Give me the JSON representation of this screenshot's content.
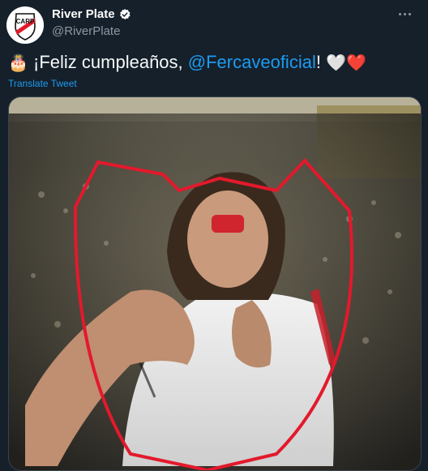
{
  "tweet": {
    "display_name": "River Plate",
    "handle": "@RiverPlate",
    "text_prefix": "¡Feliz cumpleaños, ",
    "mention": "@Fercaveoficial",
    "text_suffix": "!",
    "emoji_start": "🎂",
    "emoji_end": "🤍❤️",
    "translate_label": "Translate Tweet"
  },
  "icons": {
    "verified": "verified-badge-icon",
    "more": "more-options-icon",
    "avatar": "river-plate-crest"
  },
  "colors": {
    "background": "#15202b",
    "link": "#1d9bf0",
    "secondary_text": "#8b98a5",
    "crest_red": "#e3192c"
  }
}
